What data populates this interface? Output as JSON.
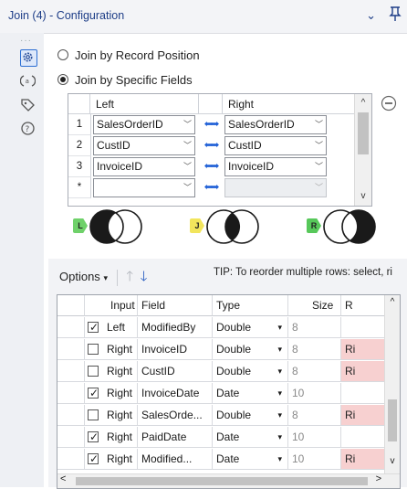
{
  "window": {
    "title": "Join (4) - Configuration",
    "collapse_glyph": "⌄"
  },
  "sidebar": {
    "dots": "···",
    "icons": [
      "gear-icon",
      "annotation-icon",
      "tag-icon",
      "help-icon"
    ]
  },
  "join_mode": {
    "option1": "Join by Record Position",
    "option2": "Join by Specific Fields",
    "selected": "Join by Specific Fields"
  },
  "join_fields": {
    "headers": {
      "left": "Left",
      "right": "Right"
    },
    "rows": [
      {
        "num": "1",
        "left": "SalesOrderID",
        "right": "SalesOrderID"
      },
      {
        "num": "2",
        "left": "CustID",
        "right": "CustID"
      },
      {
        "num": "3",
        "left": "InvoiceID",
        "right": "InvoiceID"
      },
      {
        "num": "*",
        "left": "",
        "right": ""
      }
    ]
  },
  "outputs": {
    "left": "L",
    "join": "J",
    "right": "R"
  },
  "colors": {
    "title": "#1d3d87",
    "accent": "#2d6fd3",
    "left_chip": "#6fd16a",
    "join_chip": "#f2e55c",
    "right_chip": "#57c85a",
    "rename_cell": "#f7d0d0"
  },
  "toolbar": {
    "options": "Options",
    "tip": "TIP: To reorder multiple rows: select, ri"
  },
  "field_table": {
    "headers": {
      "input": "Input",
      "field": "Field",
      "type": "Type",
      "size": "Size",
      "rename": "R"
    },
    "rows": [
      {
        "checked": true,
        "input": "Left",
        "field": "ModifiedBy",
        "type": "Double",
        "size": "8",
        "rename": ""
      },
      {
        "checked": false,
        "input": "Right",
        "field": "InvoiceID",
        "type": "Double",
        "size": "8",
        "rename": "Ri"
      },
      {
        "checked": false,
        "input": "Right",
        "field": "CustID",
        "type": "Double",
        "size": "8",
        "rename": "Ri"
      },
      {
        "checked": true,
        "input": "Right",
        "field": "InvoiceDate",
        "type": "Date",
        "size": "10",
        "rename": ""
      },
      {
        "checked": false,
        "input": "Right",
        "field": "SalesOrde...",
        "type": "Double",
        "size": "8",
        "rename": "Ri"
      },
      {
        "checked": true,
        "input": "Right",
        "field": "PaidDate",
        "type": "Date",
        "size": "10",
        "rename": ""
      },
      {
        "checked": true,
        "input": "Right",
        "field": "Modified...",
        "type": "Date",
        "size": "10",
        "rename": "Ri"
      }
    ]
  }
}
